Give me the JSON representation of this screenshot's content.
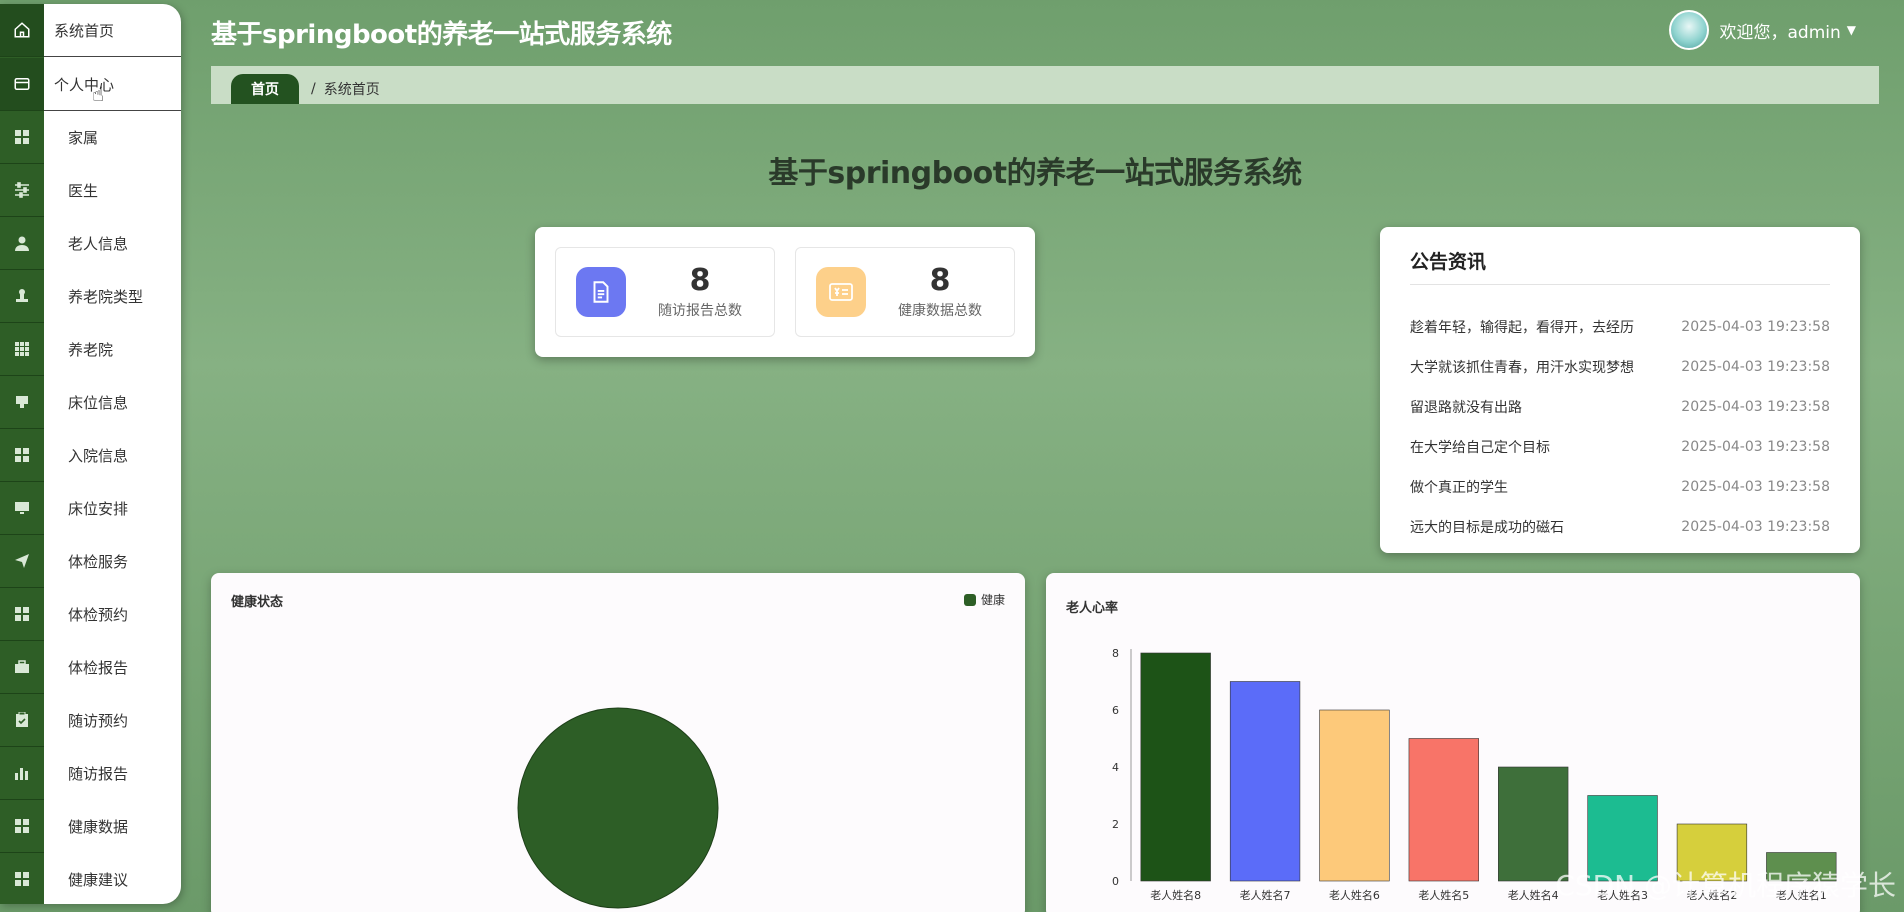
{
  "app": {
    "title": "基于springboot的养老一站式服务系统"
  },
  "user": {
    "greeting": "欢迎您，admin"
  },
  "breadcrumb": {
    "home": "首页",
    "separator": "/",
    "current": "系统首页"
  },
  "sidebar": {
    "items": [
      {
        "label": "系统首页",
        "icon": "home-icon"
      },
      {
        "label": "个人中心",
        "icon": "wallet-icon"
      },
      {
        "label": "家属",
        "icon": "grid-icon"
      },
      {
        "label": "医生",
        "icon": "sliders-icon"
      },
      {
        "label": "老人信息",
        "icon": "user-icon"
      },
      {
        "label": "养老院类型",
        "icon": "stamp-icon"
      },
      {
        "label": "养老院",
        "icon": "apps-icon"
      },
      {
        "label": "床位信息",
        "icon": "bed-icon"
      },
      {
        "label": "入院信息",
        "icon": "grid-icon"
      },
      {
        "label": "床位安排",
        "icon": "monitor-icon"
      },
      {
        "label": "体检服务",
        "icon": "send-icon"
      },
      {
        "label": "体检预约",
        "icon": "grid-icon"
      },
      {
        "label": "体检报告",
        "icon": "briefcase-icon"
      },
      {
        "label": "随访预约",
        "icon": "clipboard-icon"
      },
      {
        "label": "随访报告",
        "icon": "bar-chart-icon"
      },
      {
        "label": "健康数据",
        "icon": "grid-icon"
      },
      {
        "label": "健康建议",
        "icon": "grid-icon"
      }
    ]
  },
  "main": {
    "heading": "基于springboot的养老一站式服务系统"
  },
  "stats": [
    {
      "value": "8",
      "caption": "随访报告总数",
      "color": "#6c78f2"
    },
    {
      "value": "8",
      "caption": "健康数据总数",
      "color": "#fdd08a"
    }
  ],
  "notices": {
    "title": "公告资讯",
    "items": [
      {
        "text": "趁着年轻，输得起，看得开，去经历",
        "date": "2025-04-03 19:23:58"
      },
      {
        "text": "大学就该抓住青春，用汗水实现梦想",
        "date": "2025-04-03 19:23:58"
      },
      {
        "text": "留退路就没有出路",
        "date": "2025-04-03 19:23:58"
      },
      {
        "text": "在大学给自己定个目标",
        "date": "2025-04-03 19:23:58"
      },
      {
        "text": "做个真正的学生",
        "date": "2025-04-03 19:23:58"
      },
      {
        "text": "远大的目标是成功的磁石",
        "date": "2025-04-03 19:23:58"
      }
    ]
  },
  "pie_panel": {
    "title": "健康状态",
    "legend": "健康"
  },
  "bar_panel": {
    "title": "老人心率"
  },
  "watermark": "CSDN @计算机程序猿学长",
  "chart_data": [
    {
      "type": "pie",
      "title": "健康状态",
      "categories": [
        "健康"
      ],
      "values": [
        1
      ],
      "colors": [
        "#2d5e26"
      ],
      "legend": "top-right"
    },
    {
      "type": "bar",
      "title": "老人心率",
      "categories": [
        "老人姓名8",
        "老人姓名7",
        "老人姓名6",
        "老人姓名5",
        "老人姓名4",
        "老人姓名3",
        "老人姓名2",
        "老人姓名1"
      ],
      "values": [
        8,
        7,
        6,
        5,
        4,
        3,
        2,
        1
      ],
      "colors": [
        "#1d5317",
        "#5b6cf9",
        "#fdc97a",
        "#f87468",
        "#3e6f3a",
        "#1cbc91",
        "#d6cf3c",
        "#5e8f4e"
      ],
      "ylim": [
        0,
        8
      ],
      "yticks": [
        0,
        2,
        4,
        6,
        8
      ],
      "grid": false
    }
  ]
}
